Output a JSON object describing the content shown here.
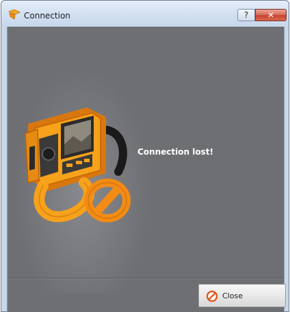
{
  "window": {
    "title": "Connection",
    "help_glyph": "?",
    "close_glyph": "✕"
  },
  "dialog": {
    "message": "Connection lost!",
    "close_button_label": "Close",
    "illustration": "camera-disconnected-icon"
  },
  "colors": {
    "client_background": "#6e6f73",
    "accent_orange": "#f7a21b",
    "no_symbol": "#e05a24"
  }
}
